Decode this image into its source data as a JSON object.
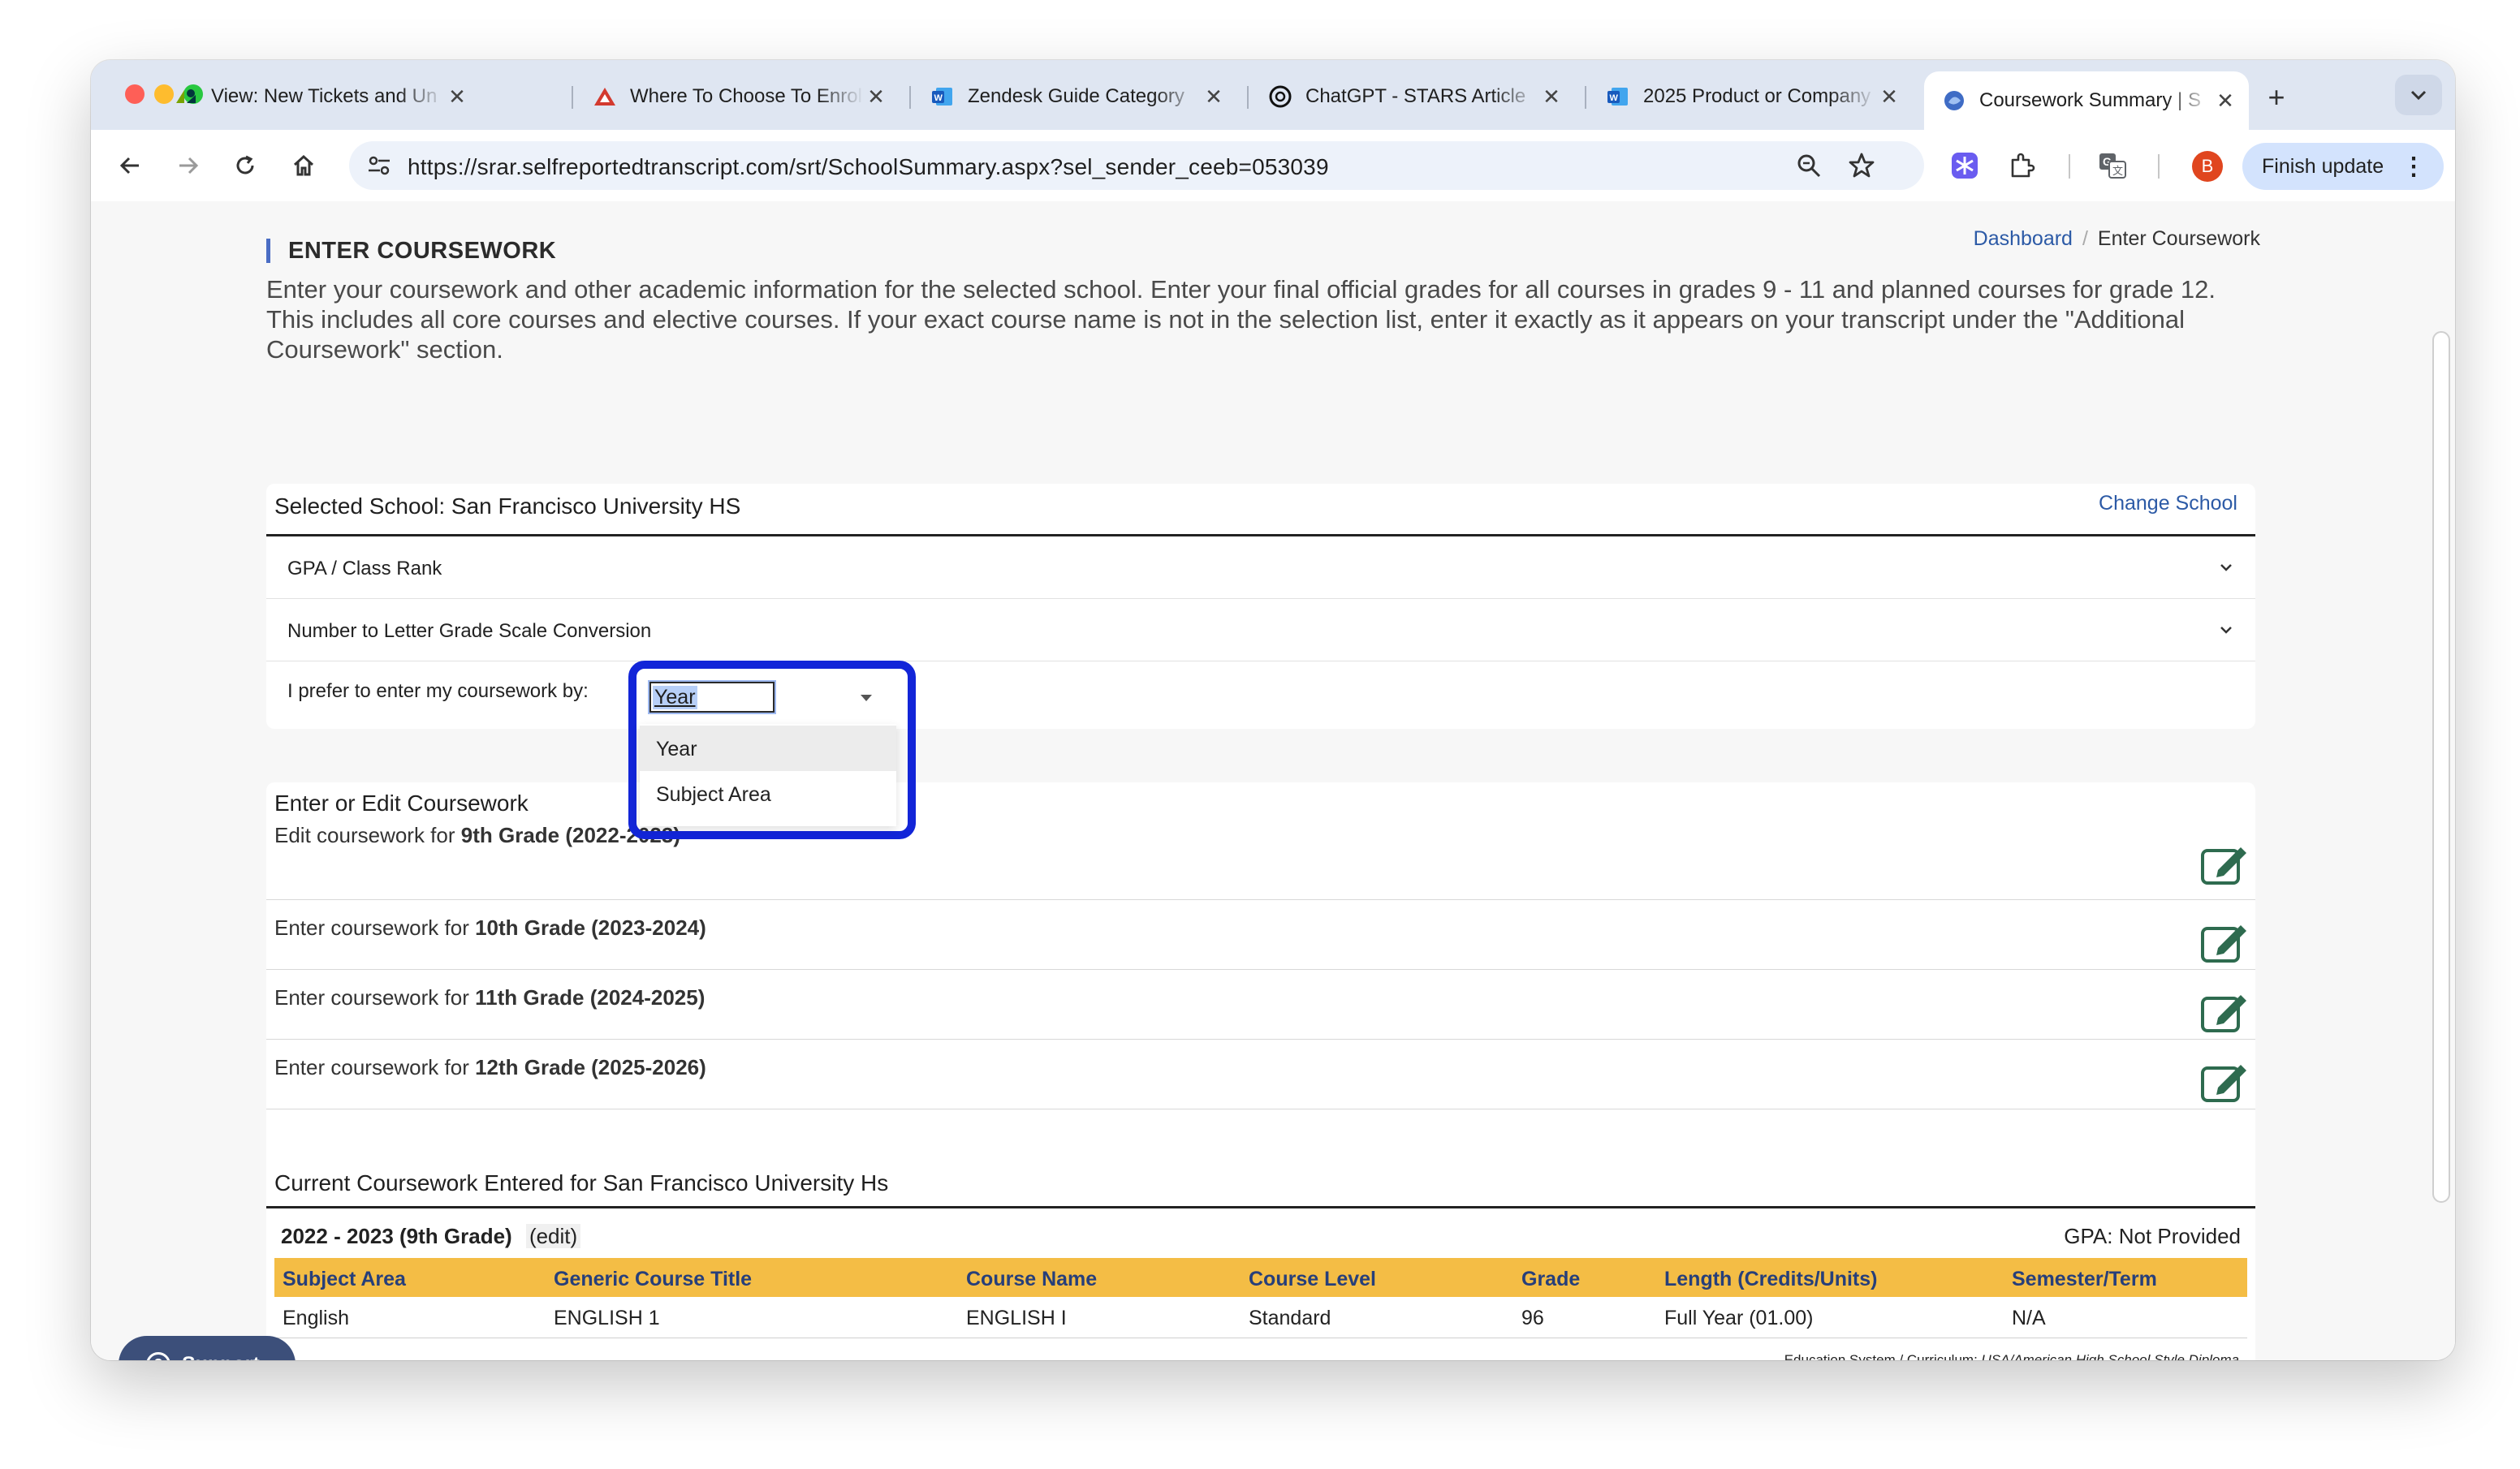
{
  "browser": {
    "tabs": [
      {
        "title": "View: New Tickets and Un",
        "favicon": "zendesk-icon"
      },
      {
        "title": "Where To Choose To Enroll",
        "favicon": "triangle-logo-icon"
      },
      {
        "title": "Zendesk Guide Category",
        "favicon": "word-doc-icon"
      },
      {
        "title": "ChatGPT - STARS Article",
        "favicon": "chatgpt-icon"
      },
      {
        "title": "2025 Product or Company",
        "favicon": "word-doc-icon"
      },
      {
        "title": "Coursework Summary | S",
        "favicon": "srar-icon"
      }
    ],
    "url": "https://srar.selfreportedtranscript.com/srt/SchoolSummary.aspx?sel_sender_ceeb=053039",
    "profile_initial": "B",
    "finish_update": "Finish update"
  },
  "page": {
    "heading": "ENTER COURSEWORK",
    "breadcrumb": {
      "home": "Dashboard",
      "current": "Enter Coursework"
    },
    "intro": "Enter your coursework and other academic information for the selected school. Enter your final official grades for all courses in grades 9 - 11 and planned courses for grade 12. This includes all core courses and elective courses. If your exact course name is not in the selection list, enter it exactly as it appears on your transcript under the \"Additional Coursework\" section."
  },
  "school_panel": {
    "title": "Selected School: San Francisco University HS",
    "change_link": "Change School",
    "accordions": [
      "GPA / Class Rank",
      "Number to Letter Grade Scale Conversion"
    ],
    "pref_label": "I prefer to enter my coursework by:",
    "pref_value": "Year",
    "pref_options": [
      "Year",
      "Subject Area"
    ]
  },
  "coursework": {
    "title": "Enter or Edit Coursework",
    "rows": [
      {
        "prefix": "Edit coursework for ",
        "grade": "9th Grade (2022-2023)"
      },
      {
        "prefix": "Enter coursework for ",
        "grade": "10th Grade (2023-2024)"
      },
      {
        "prefix": "Enter coursework for ",
        "grade": "11th Grade (2024-2025)"
      },
      {
        "prefix": "Enter coursework for ",
        "grade": "12th Grade (2025-2026)"
      }
    ]
  },
  "current": {
    "title": "Current Coursework Entered for San Francisco University Hs",
    "year_label": "2022 - 2023 (9th Grade)",
    "edit_label": "(edit)",
    "gpa": "GPA: Not Provided",
    "columns": [
      "Subject Area",
      "Generic Course Title",
      "Course Name",
      "Course Level",
      "Grade",
      "Length (Credits/Units)",
      "Semester/Term"
    ],
    "rows": [
      [
        "English",
        "ENGLISH 1",
        "ENGLISH I",
        "Standard",
        "96",
        "Full Year (01.00)",
        "N/A"
      ]
    ],
    "footnote_label": "Education System / Curriculum: ",
    "footnote_value": "USA/American High School Style Diploma"
  },
  "support_label": "Support",
  "colors": {
    "accent": "#2c5aa6",
    "table_header": "#f4bd45",
    "highlight_border": "#1225d8"
  }
}
